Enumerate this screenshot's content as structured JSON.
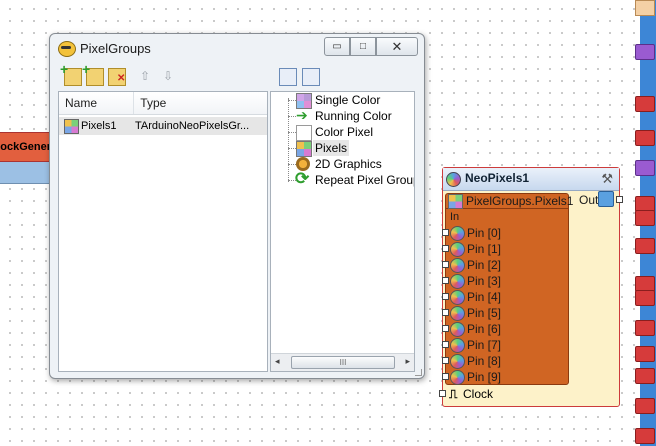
{
  "canvas": {
    "left_component": {
      "header_label": "ockGener"
    }
  },
  "window": {
    "title": "PixelGroups",
    "buttons": {
      "minimize": "▭",
      "maximize": "□",
      "close": "✕"
    },
    "toolbar": {
      "move_up": "⇧",
      "move_down": "⇩"
    },
    "list": {
      "columns": [
        "Name",
        "Type"
      ],
      "rows": [
        {
          "name": "Pixels1",
          "type": "TArduinoNeoPixelsGr..."
        }
      ]
    },
    "tree": {
      "items": [
        {
          "label": "Single Color",
          "icon": "single-color-icon"
        },
        {
          "label": "Running Color",
          "icon": "running-color-icon"
        },
        {
          "label": "Color Pixel",
          "icon": "color-pixel-icon"
        },
        {
          "label": "Pixels",
          "icon": "pixels-icon",
          "selected": true
        },
        {
          "label": "2D Graphics",
          "icon": "graphics-2d-icon"
        },
        {
          "label": "Repeat Pixel Groups",
          "icon": "repeat-icon"
        }
      ]
    },
    "scrollbar": {
      "left": "◂",
      "right": "▸",
      "thumb": "III"
    }
  },
  "component": {
    "name": "NeoPixels1",
    "group_label": "PixelGroups.Pixels1",
    "in_label": "In",
    "out_label": "Out",
    "pins": [
      "Pin [0]",
      "Pin [1]",
      "Pin [2]",
      "Pin [3]",
      "Pin [4]",
      "Pin [5]",
      "Pin [6]",
      "Pin [7]",
      "Pin [8]",
      "Pin [9]"
    ],
    "clock_label": "Clock",
    "clock_symbol": "⎍"
  }
}
